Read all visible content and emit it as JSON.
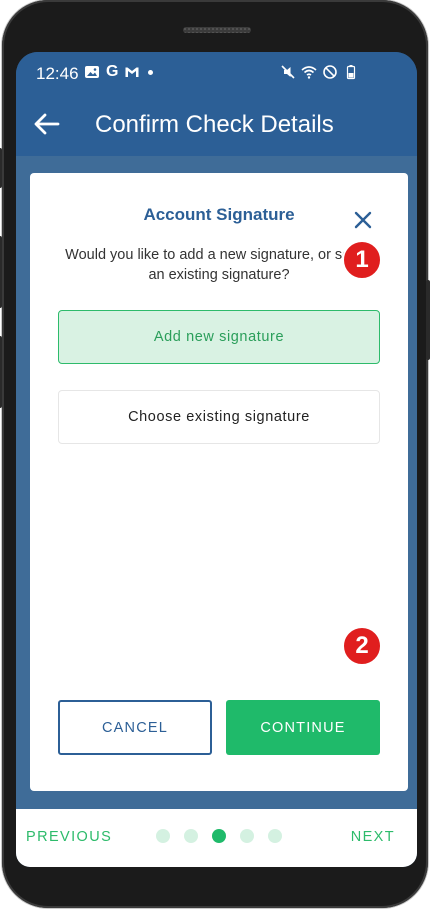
{
  "status_bar": {
    "time": "12:46",
    "left_icons": [
      "image-icon",
      "google-icon",
      "gmail-icon",
      "notification-dot-icon"
    ],
    "right_icons": [
      "mute-icon",
      "wifi-icon",
      "do-not-disturb-icon",
      "battery-icon"
    ],
    "google_glyph": "G"
  },
  "header": {
    "title": "Confirm Check Details",
    "back_icon": "back-arrow-icon"
  },
  "modal": {
    "title": "Account Signature",
    "close_icon": "close-icon",
    "message": "Would you like to add a new signature, or select an existing signature?",
    "options": [
      {
        "label": "Add new signature"
      },
      {
        "label": "Choose existing signature"
      }
    ],
    "cancel_label": "CANCEL",
    "continue_label": "CONTINUE"
  },
  "annotations": {
    "badge_1": "1",
    "badge_2": "2"
  },
  "bottom_nav": {
    "previous_label": "PREVIOUS",
    "next_label": "NEXT",
    "steps_total": 5,
    "current_step": 3
  },
  "colors": {
    "header_blue": "#2c5f96",
    "accent_green": "#1fba6a",
    "badge_red": "#e01e1e"
  }
}
